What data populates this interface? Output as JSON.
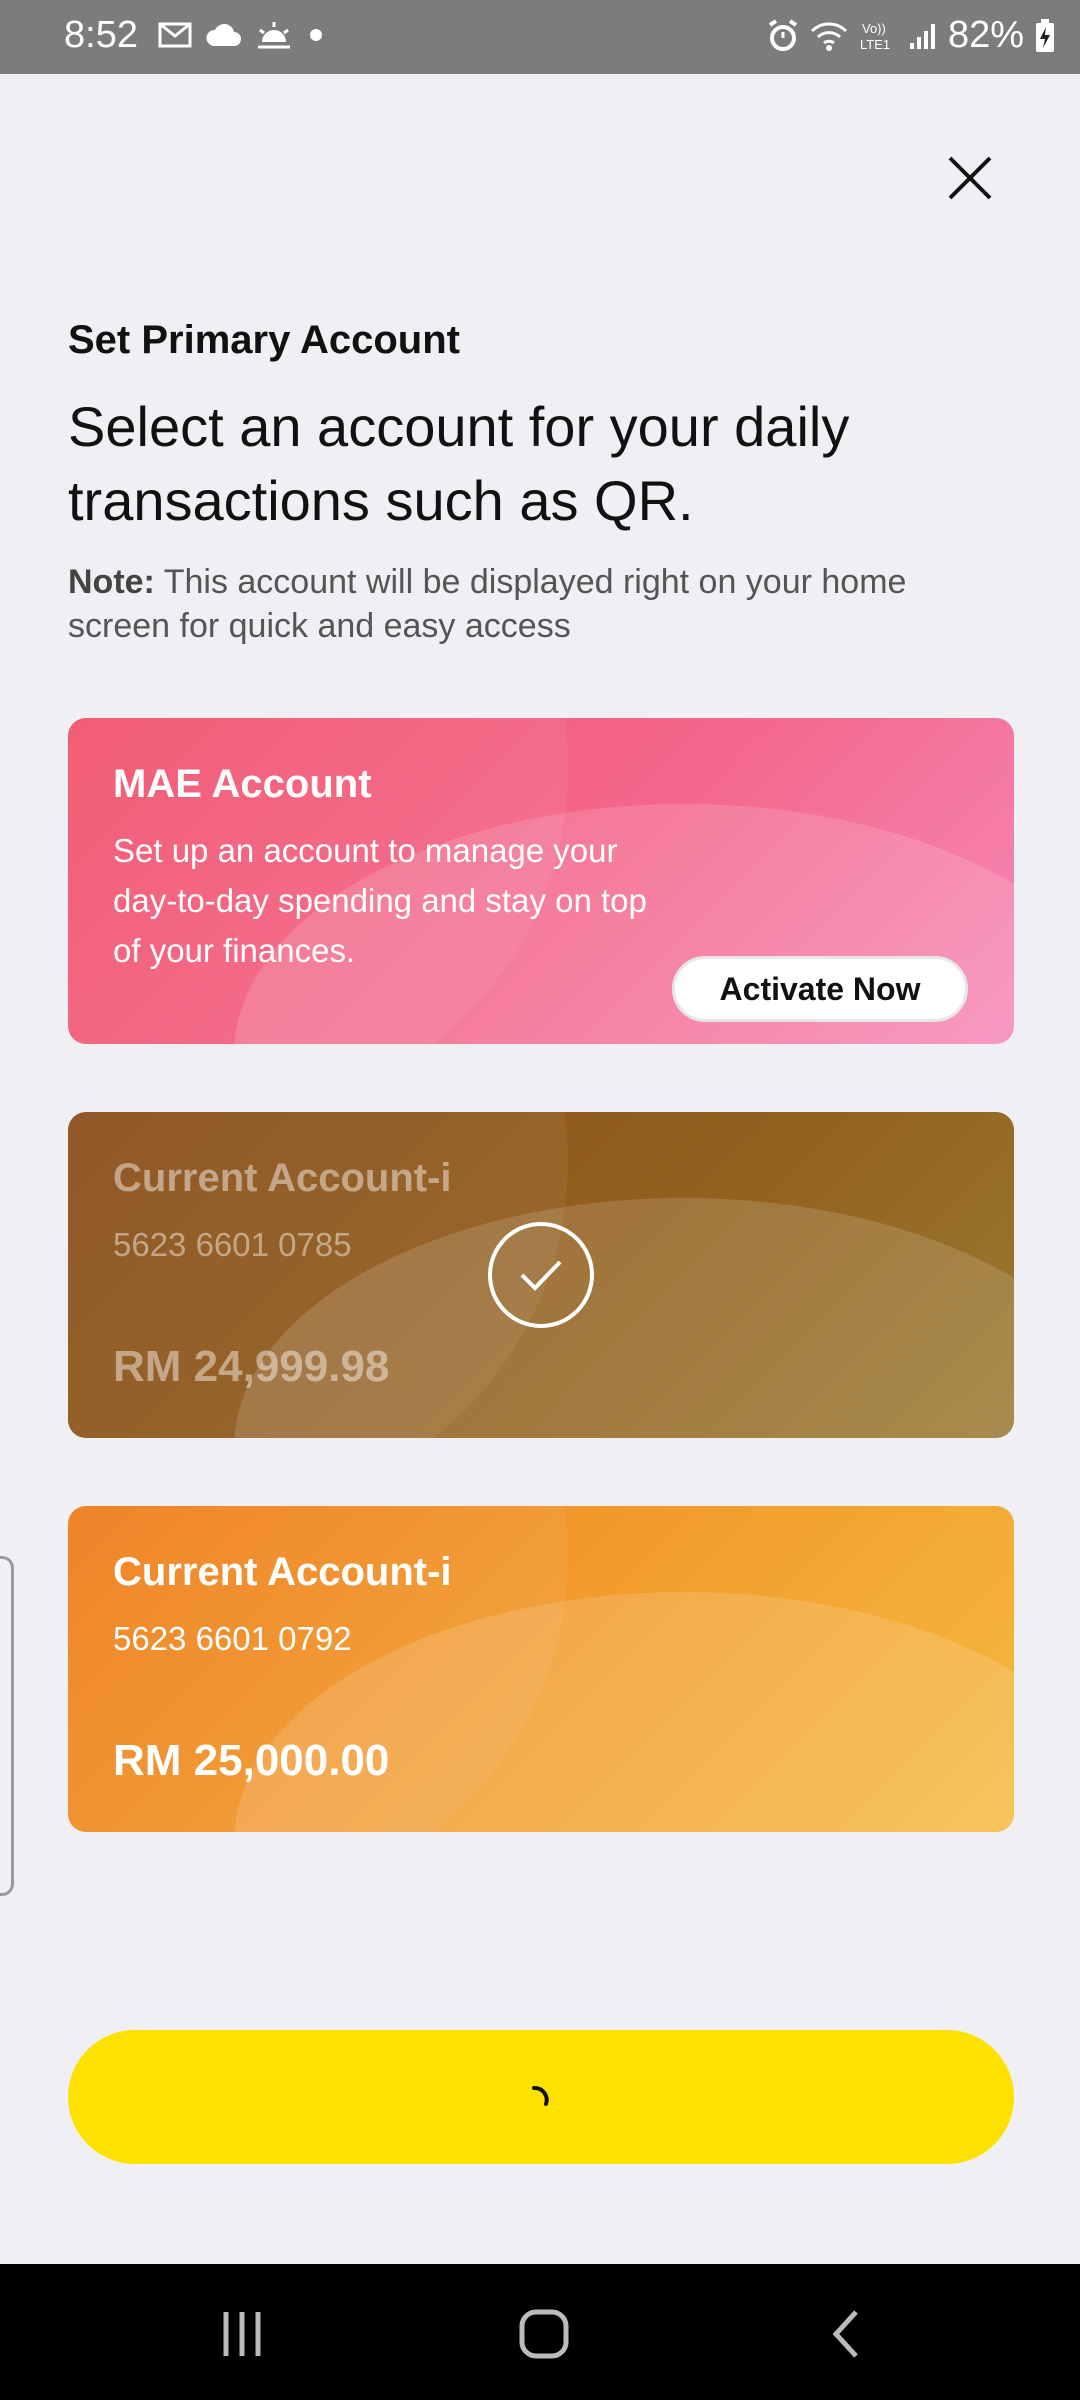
{
  "status_bar": {
    "time": "8:52",
    "battery": "82%",
    "left_icons": [
      "mail-icon",
      "cloud-icon",
      "sunrise-icon",
      "dot-icon"
    ],
    "right_icons": [
      "alarm-icon",
      "wifi-icon",
      "volte-icon",
      "signal-icon",
      "battery-icon"
    ]
  },
  "header": {
    "eyebrow": "Set Primary Account",
    "headline": "Select an account for your daily transactions such as QR.",
    "note_label": "Note:",
    "note_text": " This account will be displayed right on your home screen for quick and easy access"
  },
  "cards": {
    "mae": {
      "title": "MAE Account",
      "description": "Set up an account to manage your day-to-day spending and stay on top of your finances.",
      "action_label": "Activate Now"
    },
    "current1": {
      "title": "Current Account-i",
      "number": "5623 6601 0785",
      "balance": "RM 24,999.98",
      "selected": true
    },
    "current2": {
      "title": "Current Account-i",
      "number": "5623 6601 0792",
      "balance": "RM 25,000.00",
      "selected": false
    }
  },
  "primary_button": {
    "state": "loading"
  },
  "colors": {
    "button": "#fde200",
    "mae_card": "#f4688c",
    "current1_card": "#93621e",
    "current2_card": "#f2a030"
  }
}
